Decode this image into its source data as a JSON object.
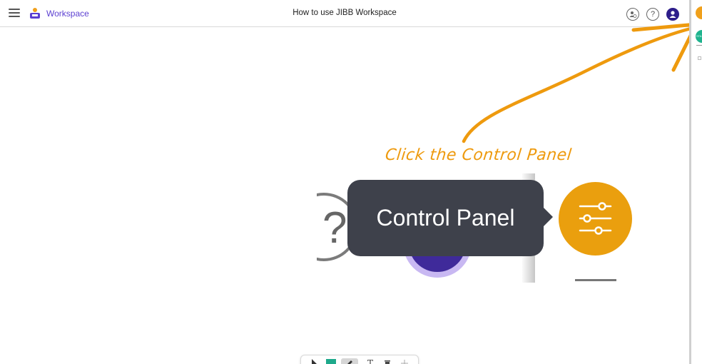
{
  "header": {
    "menu_icon": "hamburger-menu-icon",
    "logo_icon": "workspace-logo-icon",
    "brand": "Workspace",
    "title": "How to use JIBB Workspace",
    "icons": [
      "collaborators-icon",
      "help-icon",
      "user-avatar-icon"
    ]
  },
  "right_panel": {
    "control_panel_icon": "control-panel-icon",
    "start_label": "STA"
  },
  "canvas": {
    "annotation": "Click the Control Panel",
    "shot": {
      "tooltip": "Control Panel",
      "help_glyph": "?"
    }
  },
  "toolbar": {
    "tools": [
      "select-tool-icon",
      "color-swatch-icon",
      "pen-tool-icon",
      "text-tool-icon",
      "delete-tool-icon",
      "more-tool-icon"
    ],
    "text_glyph": "T"
  },
  "colors": {
    "accent_orange": "#ee9a0e",
    "brand_purple": "#5b3fd1",
    "tooltip_bg": "#3e414b",
    "swatch_green": "#1ea98b"
  }
}
